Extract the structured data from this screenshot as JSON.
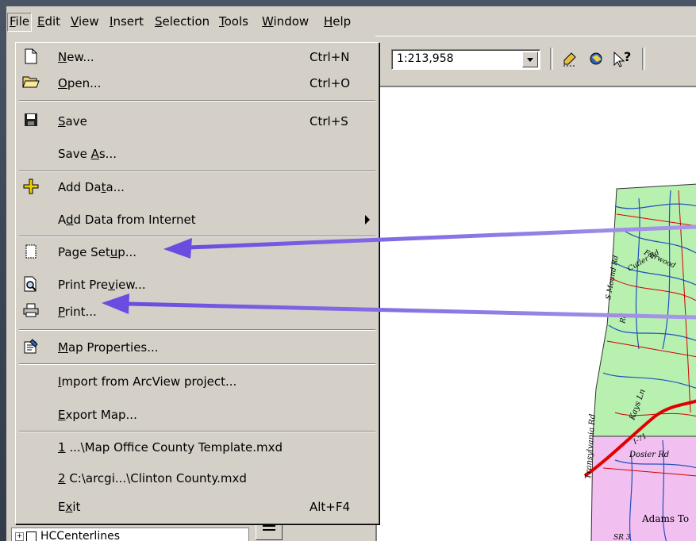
{
  "menubar": {
    "items": [
      {
        "label": "File",
        "u": "F",
        "rest": "ile"
      },
      {
        "label": "Edit",
        "u": "E",
        "rest": "dit"
      },
      {
        "label": "View",
        "u": "V",
        "rest": "iew"
      },
      {
        "label": "Insert",
        "u": "I",
        "rest": "nsert"
      },
      {
        "label": "Selection",
        "u": "S",
        "rest": "election"
      },
      {
        "label": "Tools",
        "u": "T",
        "rest": "ools"
      },
      {
        "label": "Window",
        "u": "W",
        "rest": "indow"
      },
      {
        "label": "Help",
        "u": "H",
        "rest": "elp"
      }
    ]
  },
  "toolbar": {
    "scale_value": "1:213,958",
    "icons": [
      "edit-tool-icon",
      "identify-icon",
      "whats-this-help-icon"
    ],
    "help_glyph": "?"
  },
  "file_menu": {
    "new": {
      "pre": "",
      "u": "N",
      "post": "ew...",
      "shortcut": "Ctrl+N"
    },
    "open": {
      "pre": "",
      "u": "O",
      "post": "pen...",
      "shortcut": "Ctrl+O"
    },
    "save": {
      "pre": "",
      "u": "S",
      "post": "ave",
      "shortcut": "Ctrl+S"
    },
    "save_as": {
      "pre": "Save ",
      "u": "A",
      "post": "s..."
    },
    "add_data": {
      "pre": "Add Da",
      "u": "t",
      "post": "a..."
    },
    "add_data_internet": {
      "pre": "A",
      "u": "d",
      "post": "d Data from Internet"
    },
    "page_setup": {
      "pre": "Page Set",
      "u": "u",
      "post": "p..."
    },
    "print_preview": {
      "pre": "Print Pre",
      "u": "v",
      "post": "iew..."
    },
    "print": {
      "pre": "",
      "u": "P",
      "post": "rint..."
    },
    "map_properties": {
      "pre": "",
      "u": "M",
      "post": "ap Properties..."
    },
    "import_arcview": {
      "pre": "",
      "u": "I",
      "post": "mport from ArcView project..."
    },
    "export_map": {
      "pre": "",
      "u": "E",
      "post": "xport Map..."
    },
    "recent_1": {
      "pre": "",
      "u": "1",
      "post": " ...\\Map Office County Template.mxd"
    },
    "recent_2": {
      "pre": "",
      "u": "2",
      "post": " C:\\arcgi...\\Clinton County.mxd"
    },
    "exit": {
      "pre": "E",
      "u": "x",
      "post": "it",
      "shortcut": "Alt+F4"
    }
  },
  "toc": {
    "layer_name": "HCCenterlines",
    "expand_glyph": "+"
  },
  "map": {
    "labels": {
      "transylvania_rd": "Transylvania Rd",
      "dosier_rd": "Dosier Rd",
      "adams_to": "Adams To",
      "kays_ln": "Kays Ln",
      "mound_rd": "S Mound Rd",
      "fairwood": "Fairwood",
      "cutler_rd": "Cutler Rd",
      "sr3": "SR 3",
      "s_rd": "Rd",
      "i71": "I-71"
    },
    "colors": {
      "upper_county": "#b8f0b0",
      "lower_county": "#f2c0f0",
      "major_road": "#e00000",
      "road_net": "#2050c0",
      "annotation_arrow": "#7a5ad8"
    }
  }
}
